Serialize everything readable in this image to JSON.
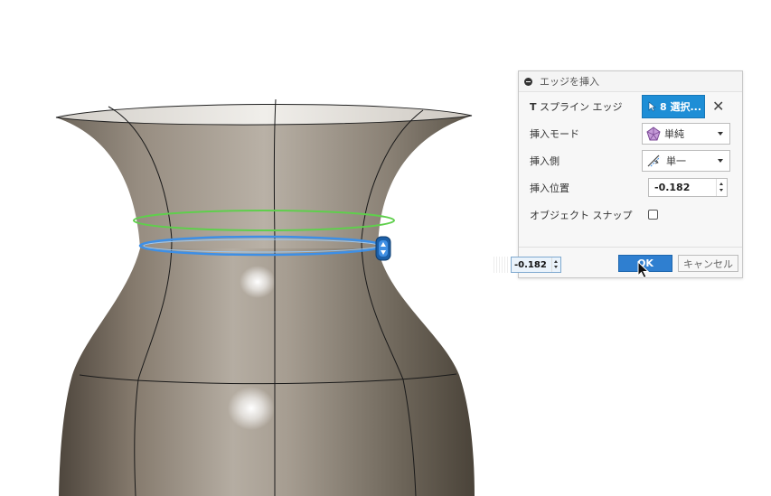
{
  "dialog": {
    "title": "エッジを挿入",
    "rows": {
      "tspline_edge": {
        "label_bold": "T",
        "label": "スプライン エッジ",
        "select_label": "8 選択..."
      },
      "insert_mode": {
        "label": "挿入モード",
        "value": "単純"
      },
      "insert_side": {
        "label": "挿入側",
        "value": "単一"
      },
      "insert_position": {
        "label": "挿入位置",
        "value": "-0.182"
      },
      "object_snap": {
        "label": "オブジェクト スナップ"
      }
    },
    "ok_label": "OK",
    "cancel_label": "キャンセル"
  },
  "floating_input": {
    "value": "-0.182"
  },
  "colors": {
    "accent_blue": "#1e8ed6",
    "selected_edge": "#3d8fe6",
    "preview_edge": "#5fcf4c",
    "body_gray": "#8a8070"
  },
  "icons": {
    "collapse": "collapse-icon",
    "select": "cursor-arrow-icon",
    "clear": "close-icon",
    "mode": "tspline-face-icon",
    "side": "insert-side-icon",
    "handle": "move-handle-icon"
  }
}
